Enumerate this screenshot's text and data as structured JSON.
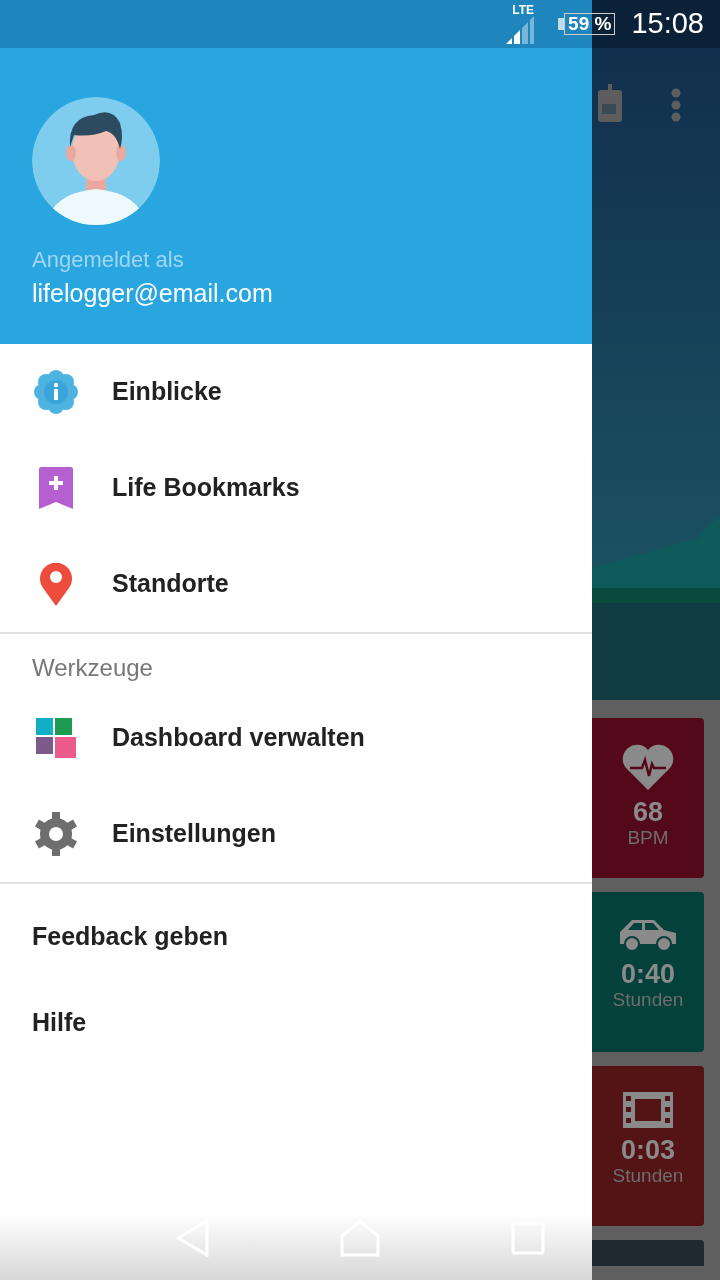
{
  "status_bar": {
    "network": "LTE",
    "battery": "59 %",
    "time": "15:08"
  },
  "drawer": {
    "header": {
      "label": "Angemeldet als",
      "email": "lifelogger@email.com"
    },
    "sections": [
      {
        "items": [
          {
            "kind": "insights",
            "label": "Einblicke"
          },
          {
            "kind": "bookmark",
            "label": "Life Bookmarks"
          },
          {
            "kind": "location",
            "label": "Standorte"
          }
        ]
      },
      {
        "title": "Werkzeuge",
        "items": [
          {
            "kind": "dashboard",
            "label": "Dashboard verwalten"
          },
          {
            "kind": "settings",
            "label": "Einstellungen"
          }
        ]
      },
      {
        "items": [
          {
            "kind": "plain",
            "label": "Feedback geben"
          },
          {
            "kind": "plain",
            "label": "Hilfe"
          }
        ]
      }
    ]
  },
  "background_cards": [
    {
      "kind": "heart",
      "value": "68",
      "unit": "BPM",
      "color": "#54091a"
    },
    {
      "kind": "car",
      "value": "0:40",
      "unit": "Stunden",
      "color": "#03413a"
    },
    {
      "kind": "film",
      "value": "0:03",
      "unit": "Stunden",
      "color": "#541314"
    },
    {
      "kind": "blank",
      "color": "#1f2a30"
    }
  ]
}
